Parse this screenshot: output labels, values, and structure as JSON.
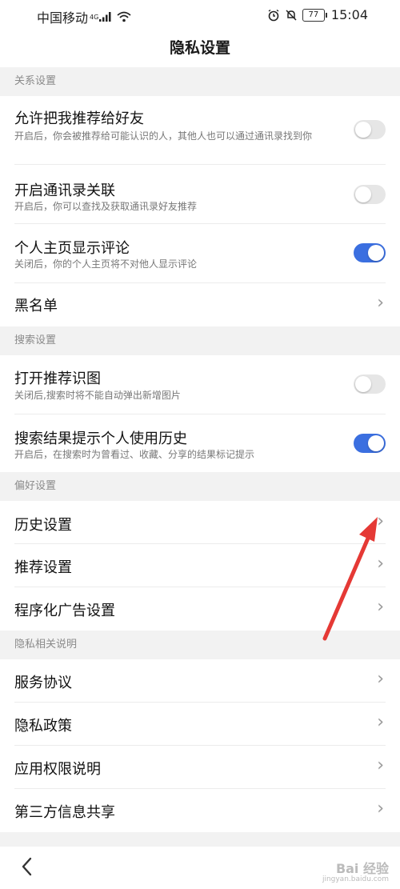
{
  "status_bar": {
    "carrier": "中国移动",
    "network": "4G",
    "battery": "77",
    "time": "15:04"
  },
  "title": "隐私设置",
  "sections": {
    "relation": {
      "header": "关系设置",
      "recommend_friends": {
        "title": "允许把我推荐给好友",
        "desc": "开启后，你会被推荐给可能认识的人，其他人也可以通过通讯录找到你",
        "enabled": false
      },
      "contacts_link": {
        "title": "开启通讯录关联",
        "desc": "开启后，你可以查找及获取通讯录好友推荐",
        "enabled": false
      },
      "show_comments": {
        "title": "个人主页显示评论",
        "desc": "关闭后，你的个人主页将不对他人显示评论",
        "enabled": true
      },
      "blacklist": {
        "title": "黑名单"
      }
    },
    "search": {
      "header": "搜索设置",
      "recommend_image": {
        "title": "打开推荐识图",
        "desc": "关闭后,搜索时将不能自动弹出新增图片",
        "enabled": false
      },
      "history_hint": {
        "title": "搜索结果提示个人使用历史",
        "desc": "开启后，在搜索时为曾看过、收藏、分享的结果标记提示",
        "enabled": true
      }
    },
    "preference": {
      "header": "偏好设置",
      "history_settings": {
        "title": "历史设置"
      },
      "recommend_settings": {
        "title": "推荐设置"
      },
      "ad_settings": {
        "title": "程序化广告设置"
      }
    },
    "privacy_info": {
      "header": "隐私相关说明",
      "service_agreement": {
        "title": "服务协议"
      },
      "privacy_policy": {
        "title": "隐私政策"
      },
      "app_permissions": {
        "title": "应用权限说明"
      },
      "third_party": {
        "title": "第三方信息共享"
      }
    }
  },
  "watermark": {
    "text": "Bai 经验",
    "sub": "jingyan.baidu.com"
  },
  "colors": {
    "toggle_on": "#3b6fe0",
    "toggle_off": "#e6e6e6",
    "arrow": "#e53935"
  },
  "icons": {
    "back": "chevron-left-icon",
    "row_arrow": "chevron-right-icon"
  }
}
